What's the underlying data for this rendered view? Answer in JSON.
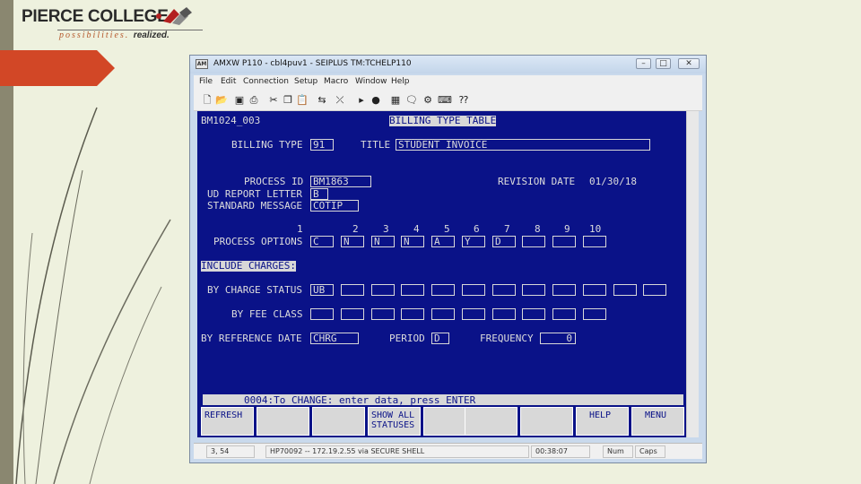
{
  "logo": {
    "main": "PIERCE COLLEGE",
    "tagline": "possibilities.",
    "tagline_bold": "realized."
  },
  "window": {
    "title": "AMXW P110 - cbl4puv1 - SEIPLUS TM:TCHELP110",
    "controls": [
      "minimize",
      "maximize",
      "close"
    ]
  },
  "menu": [
    "File",
    "Edit",
    "Connection",
    "Setup",
    "Macro",
    "Window",
    "Help"
  ],
  "toolbar_icons": [
    "new-icon",
    "open-icon",
    "save-icon",
    "print-icon",
    "cut-icon",
    "copy-icon",
    "paste-icon",
    "connect-icon",
    "disconnect-icon",
    "play-icon",
    "record-icon",
    "grid-icon",
    "chat-icon",
    "settings-icon",
    "keyboard-icon",
    "help-icon"
  ],
  "terminal": {
    "screen_id": "BM1024_003",
    "screen_title": "BILLING TYPE TABLE",
    "billing_type_label": "BILLING TYPE",
    "billing_type_value": "91",
    "title_label": "TITLE",
    "title_value": "STUDENT INVOICE",
    "process_id_label": "PROCESS ID",
    "process_id_value": "BM1863",
    "revision_date_label": "REVISION DATE",
    "revision_date_value": "01/30/18",
    "ud_report_letter_label": "UD REPORT LETTER",
    "ud_report_letter_value": "B",
    "standard_message_label": "STANDARD MESSAGE",
    "standard_message_value": "COTIP",
    "option_numbers": [
      "1",
      "2",
      "3",
      "4",
      "5",
      "6",
      "7",
      "8",
      "9",
      "10"
    ],
    "process_options_label": "PROCESS OPTIONS",
    "process_options": [
      "C",
      "N",
      "N",
      "N",
      "A",
      "Y",
      "D",
      "",
      "",
      ""
    ],
    "include_charges_label": "INCLUDE CHARGES:",
    "charge_status_label": "BY CHARGE STATUS",
    "charge_status": [
      "UB",
      "",
      "",
      "",
      "",
      "",
      "",
      "",
      "",
      "",
      "",
      ""
    ],
    "fee_class_label": "BY FEE CLASS",
    "fee_class": [
      "",
      "",
      "",
      "",
      "",
      "",
      "",
      "",
      "",
      ""
    ],
    "ref_date_label": "BY REFERENCE DATE",
    "ref_date_value": "CHRG",
    "period_label": "PERIOD",
    "period_value": "D",
    "frequency_label": "FREQUENCY",
    "frequency_value": "0",
    "message": "0004:To CHANGE: enter data, press ENTER"
  },
  "fkeys": [
    {
      "label": "REFRESH"
    },
    {
      "label": ""
    },
    {
      "label": ""
    },
    {
      "label": "SHOW ALL\nSTATUSES"
    },
    {
      "label": ""
    },
    {
      "label": ""
    },
    {
      "label": ""
    },
    {
      "label": "HELP"
    },
    {
      "label": "MENU"
    }
  ],
  "status": {
    "cursor": "3, 54",
    "connection": "HP70092 -- 172.19.2.55 via SECURE SHELL",
    "time": "00:38:07",
    "num": "Num",
    "caps": "Caps"
  },
  "colors": {
    "terminal_bg": "#0a1288",
    "terminal_fg": "#dcdcdc",
    "accent_orange": "#d24726"
  }
}
